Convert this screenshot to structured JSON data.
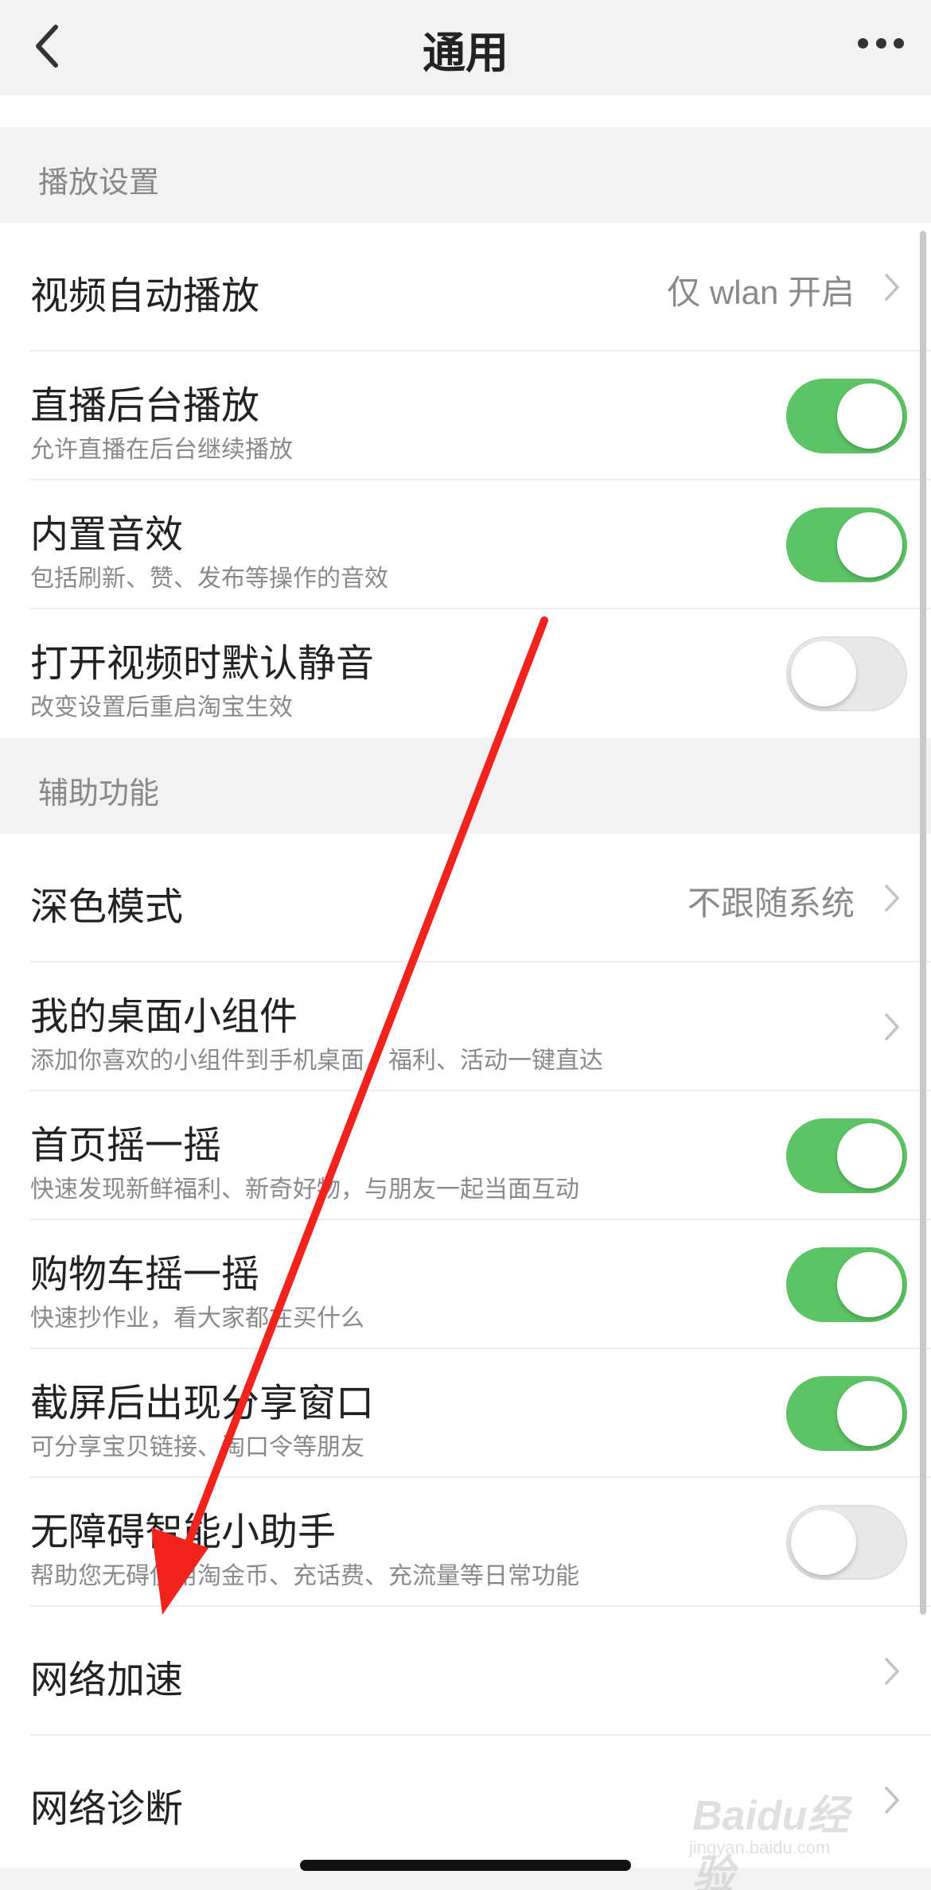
{
  "navbar": {
    "title": "通用",
    "back_icon": "chevron-left-icon",
    "more_icon": "more-dots-icon"
  },
  "sections": {
    "playback": {
      "header": "播放设置",
      "rows": [
        {
          "title": "视频自动播放",
          "value": "仅 wlan 开启",
          "control": "chevron"
        },
        {
          "title": "直播后台播放",
          "subtitle": "允许直播在后台继续播放",
          "control": "toggle",
          "on": true
        },
        {
          "title": "内置音效",
          "subtitle": "包括刷新、赞、发布等操作的音效",
          "control": "toggle",
          "on": true
        },
        {
          "title": "打开视频时默认静音",
          "subtitle": "改变设置后重启淘宝生效",
          "control": "toggle",
          "on": false
        }
      ]
    },
    "accessibility": {
      "header": "辅助功能",
      "rows": [
        {
          "title": "深色模式",
          "value": "不跟随系统",
          "control": "chevron"
        },
        {
          "title": "我的桌面小组件",
          "subtitle": "添加你喜欢的小组件到手机桌面，福利、活动一键直达",
          "control": "chevron"
        },
        {
          "title": "首页摇一摇",
          "subtitle": "快速发现新鲜福利、新奇好物，与朋友一起当面互动",
          "control": "toggle",
          "on": true
        },
        {
          "title": "购物车摇一摇",
          "subtitle": "快速抄作业，看大家都在买什么",
          "control": "toggle",
          "on": true
        },
        {
          "title": "截屏后出现分享窗口",
          "subtitle": "可分享宝贝链接、淘口令等朋友",
          "control": "toggle",
          "on": true
        },
        {
          "title": "无障碍智能小助手",
          "subtitle": "帮助您无碍使用淘金币、充话费、充流量等日常功能",
          "control": "toggle",
          "on": false
        },
        {
          "title": "网络加速",
          "control": "chevron"
        },
        {
          "title": "网络诊断",
          "control": "chevron"
        }
      ]
    }
  },
  "colors": {
    "toggle_on": "#5cc464",
    "toggle_off": "#e9e9e9",
    "annotation_arrow": "#f2231d",
    "background": "#f2f2f2"
  },
  "watermark": {
    "logo": "Baidu经验",
    "sub": "jingyan.baidu.com"
  }
}
